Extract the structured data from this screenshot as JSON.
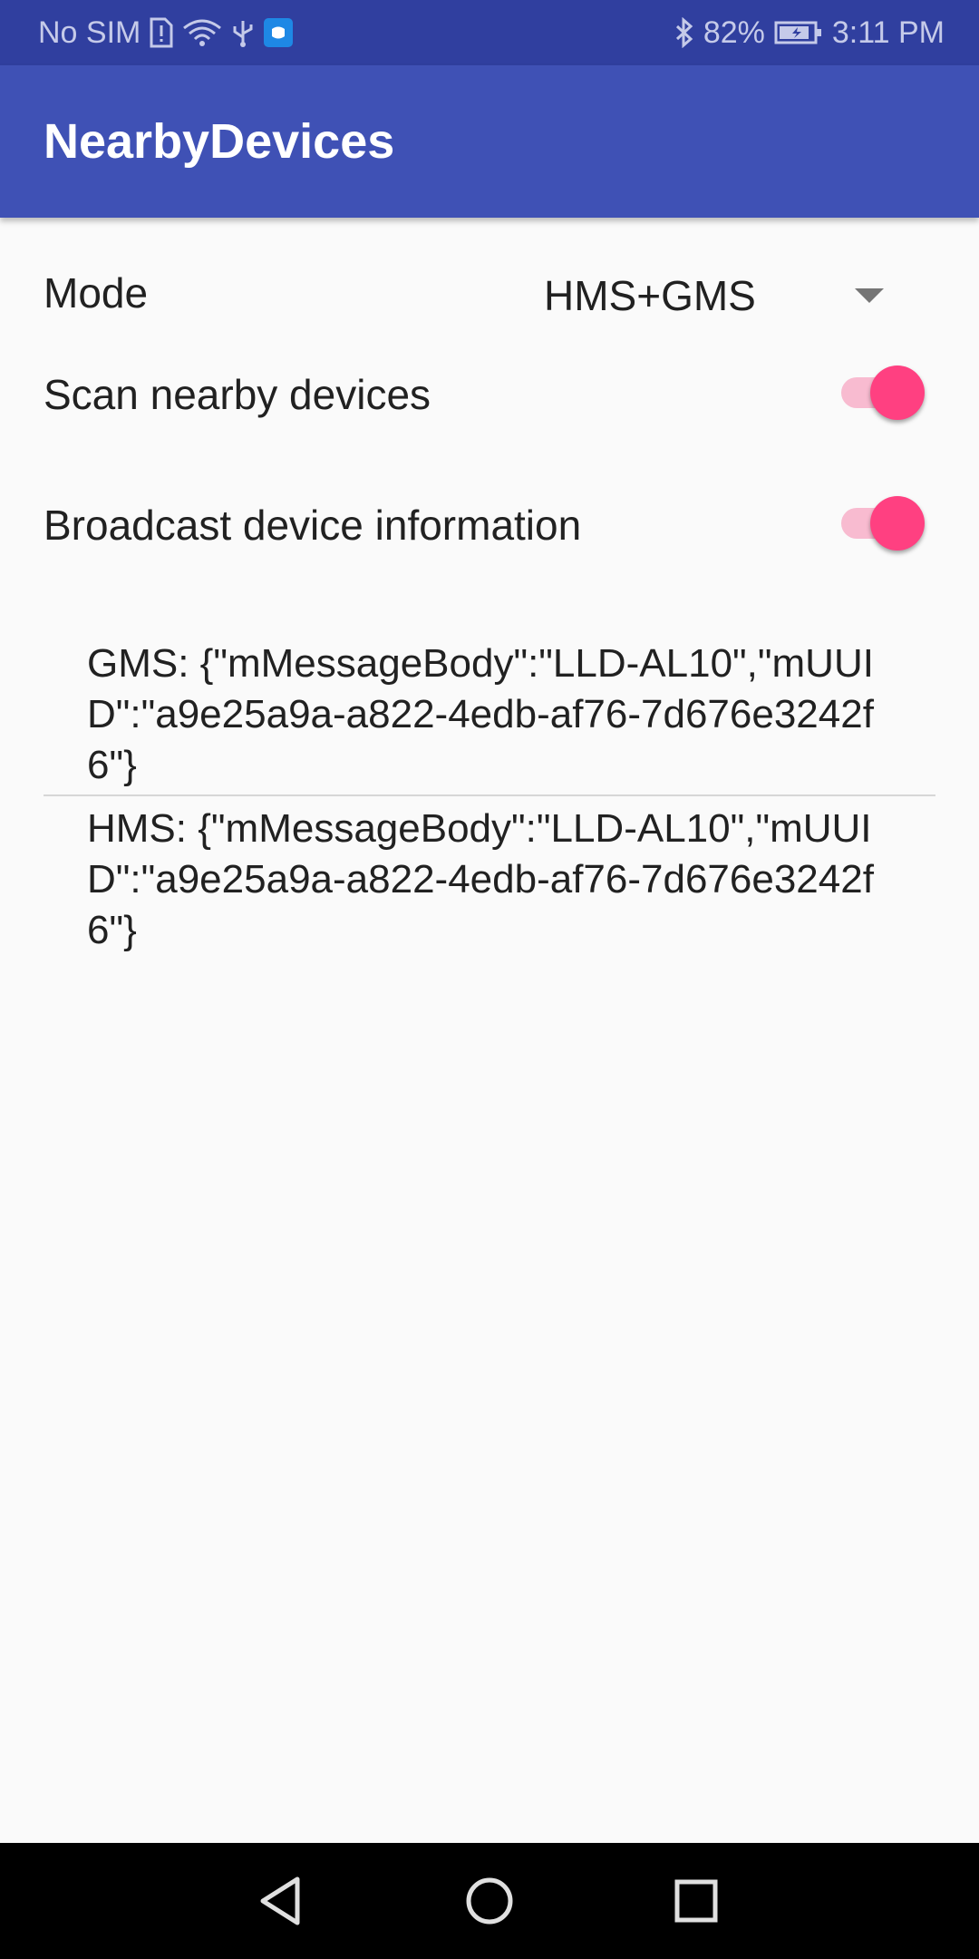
{
  "status_bar": {
    "carrier": "No SIM",
    "battery_percent": "82%",
    "time": "3:11 PM",
    "icons": [
      "sim-alert-icon",
      "wifi-icon",
      "usb-icon",
      "app-notification-icon",
      "bluetooth-icon",
      "battery-charging-icon"
    ],
    "background_color": "#303f9f"
  },
  "app_bar": {
    "title": "NearbyDevices",
    "background_color": "#3f51b5"
  },
  "settings": {
    "mode_label": "Mode",
    "mode_value": "HMS+GMS",
    "scan_label": "Scan nearby devices",
    "scan_enabled": true,
    "broadcast_label": "Broadcast device information",
    "broadcast_enabled": true,
    "accent_color": "#ff4081"
  },
  "messages": [
    "GMS: {\"mMessageBody\":\"LLD-AL10\",\"mUUID\":\"a9e25a9a-a822-4edb-af76-7d676e3242f6\"}",
    "HMS: {\"mMessageBody\":\"LLD-AL10\",\"mUUID\":\"a9e25a9a-a822-4edb-af76-7d676e3242f6\"}"
  ],
  "nav_bar": {
    "buttons": [
      "back-icon",
      "home-icon",
      "recents-icon"
    ]
  }
}
